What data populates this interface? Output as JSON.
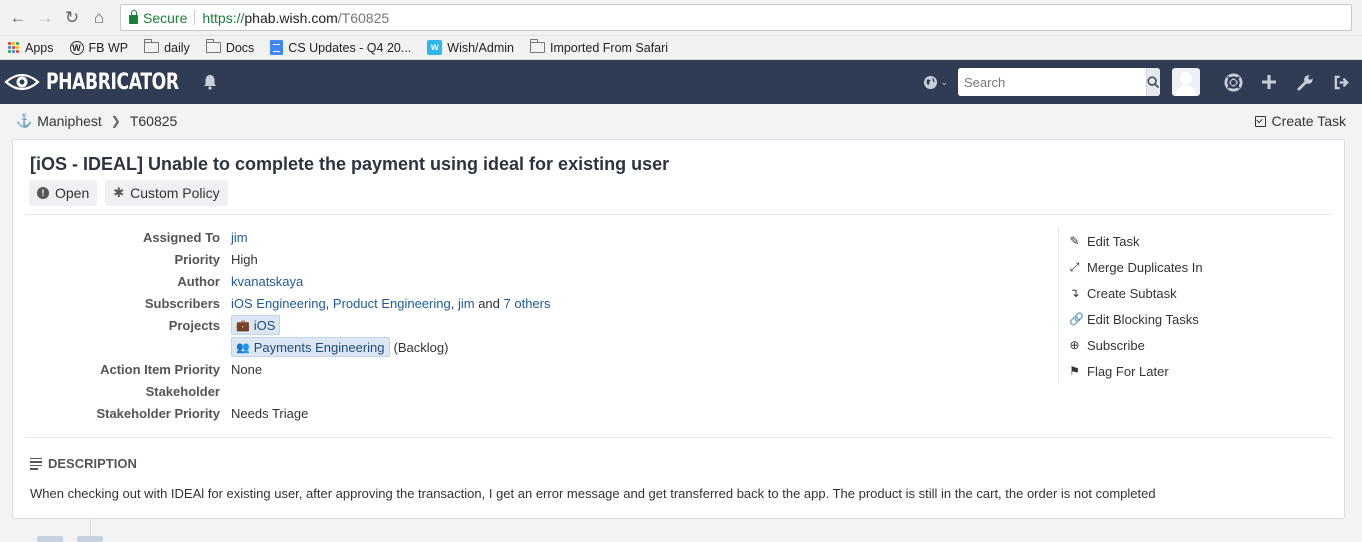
{
  "browser": {
    "secure_label": "Secure",
    "url_scheme": "https://",
    "url_host": "phab.wish.com",
    "url_path": "/T60825",
    "bookmarks": [
      {
        "label": "Apps",
        "icon": "apps-grid-icon"
      },
      {
        "label": "FB WP",
        "icon": "wordpress-icon"
      },
      {
        "label": "daily",
        "icon": "folder-icon"
      },
      {
        "label": "Docs",
        "icon": "folder-icon"
      },
      {
        "label": "CS Updates - Q4 20...",
        "icon": "google-docs-icon"
      },
      {
        "label": "Wish/Admin",
        "icon": "wish-icon"
      },
      {
        "label": "Imported From Safari",
        "icon": "folder-icon"
      }
    ]
  },
  "header": {
    "brand": "PHABRICATOR",
    "search_placeholder": "Search"
  },
  "crumbs": {
    "app": "Maniphest",
    "task_id": "T60825",
    "create_task": "Create Task"
  },
  "task": {
    "title": "[iOS - IDEAL] Unable to complete the payment using ideal for existing user",
    "status": "Open",
    "policy": "Custom Policy",
    "properties": {
      "assigned_to_label": "Assigned To",
      "assigned_to": "jim",
      "priority_label": "Priority",
      "priority": "High",
      "author_label": "Author",
      "author": "kvanatskaya",
      "subscribers_label": "Subscribers",
      "subscribers": [
        "iOS Engineering",
        "Product Engineering",
        "jim"
      ],
      "subscribers_and": "and",
      "subscribers_more": "7 others",
      "projects_label": "Projects",
      "projects": [
        {
          "name": "iOS",
          "icon": "briefcase-icon",
          "suffix": ""
        },
        {
          "name": "Payments Engineering",
          "icon": "users-icon",
          "suffix": "(Backlog)"
        }
      ],
      "action_item_priority_label": "Action Item Priority",
      "action_item_priority": "None",
      "stakeholder_label": "Stakeholder",
      "stakeholder": "",
      "stakeholder_priority_label": "Stakeholder Priority",
      "stakeholder_priority": "Needs Triage"
    },
    "actions": [
      {
        "label": "Edit Task",
        "icon": "pencil-icon"
      },
      {
        "label": "Merge Duplicates In",
        "icon": "compress-icon"
      },
      {
        "label": "Create Subtask",
        "icon": "level-down-icon"
      },
      {
        "label": "Edit Blocking Tasks",
        "icon": "link-icon"
      },
      {
        "label": "Subscribe",
        "icon": "plus-circle-icon"
      },
      {
        "label": "Flag For Later",
        "icon": "flag-icon"
      }
    ],
    "description_heading": "DESCRIPTION",
    "description": "When checking out with IDEAl for existing user, after approving the transaction, I get an error message and get transferred back to the app. The product is still in the cart, the order is not completed"
  },
  "colors": {
    "header_bg": "#2f3c53",
    "link": "#1e5a9a",
    "secure_green": "#188038"
  }
}
